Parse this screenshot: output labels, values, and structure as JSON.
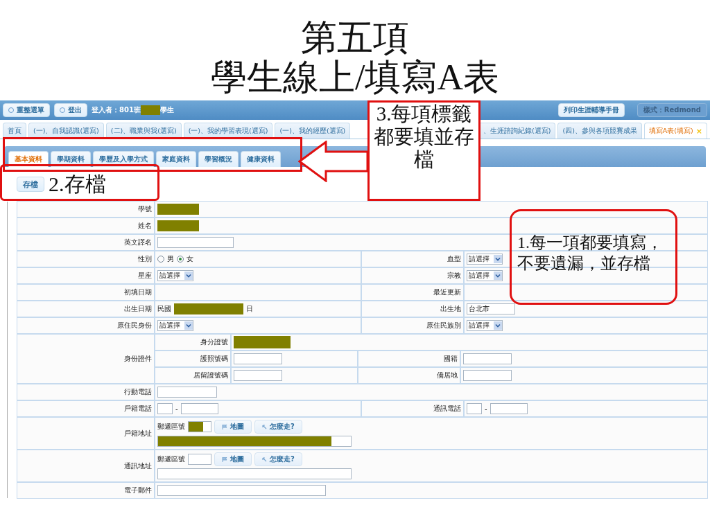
{
  "slide_title": [
    "第五項",
    "學生線上/填寫A表"
  ],
  "top_bar": {
    "buttons": [
      "重整選單",
      "登出"
    ],
    "login_prefix": "登入者：801班",
    "login_suffix": "學生",
    "print_button": "列印生涯輔導手冊",
    "theme": "樣式：Redmond"
  },
  "tabs": [
    {
      "label": "首頁",
      "selected": false
    },
    {
      "label": "(一)、自我認識(選寫)",
      "selected": false
    },
    {
      "label": "(二)、職業與我(選寫)",
      "selected": false
    },
    {
      "label": "(一)、我的學習表現(選寫)",
      "selected": false
    },
    {
      "label": "(一)、我的經歷(選寫)",
      "selected": false
    },
    {
      "label": "、生涯諮詢紀錄(選寫)",
      "selected": false
    },
    {
      "label": "(四)、參與各項競賽成果",
      "selected": false
    },
    {
      "label": "填寫A表(填寫)",
      "selected": true,
      "close": "×"
    }
  ],
  "subtabs": [
    {
      "label": "基本資料",
      "selected": true
    },
    {
      "label": "學期資料",
      "selected": false
    },
    {
      "label": "學歷及入學方式",
      "selected": false
    },
    {
      "label": "家庭資料",
      "selected": false
    },
    {
      "label": "學習概況",
      "selected": false
    },
    {
      "label": "健康資料",
      "selected": false
    }
  ],
  "save_button": "存檔",
  "form": {
    "rows": [
      {
        "label": "學號",
        "kind": "redacted"
      },
      {
        "label": "姓名",
        "kind": "redacted"
      },
      {
        "label": "英文譯名",
        "kind": "input"
      },
      {
        "label": "性別",
        "kind": "radio",
        "options": [
          {
            "label": "男",
            "selected": false
          },
          {
            "label": "女",
            "selected": true
          }
        ],
        "right": {
          "label": "血型",
          "kind": "select",
          "value": "請選擇"
        }
      },
      {
        "label": "星座",
        "kind": "select",
        "value": "請選擇",
        "right": {
          "label": "宗教",
          "kind": "select",
          "value": "請選擇"
        }
      },
      {
        "label": "初填日期",
        "kind": "empty",
        "right": {
          "label": "最近更新",
          "kind": "empty"
        }
      },
      {
        "label": "出生日期",
        "kind": "date",
        "prefix": "民國",
        "suffix": "日",
        "right": {
          "label": "出生地",
          "kind": "input",
          "value": "台北市"
        }
      },
      {
        "label": "原住民身份",
        "kind": "select",
        "value": "請選擇",
        "right": {
          "label": "原住民族別",
          "kind": "select",
          "value": "請選擇"
        }
      },
      {
        "label": "身份證件",
        "kind": "group",
        "children": [
          {
            "label": "身分證號",
            "kind": "redacted"
          },
          {
            "label": "護照號碼",
            "kind": "input",
            "right": {
              "label": "國籍",
              "kind": "input"
            }
          },
          {
            "label": "居留證號碼",
            "kind": "input",
            "right": {
              "label": "僑居地",
              "kind": "input"
            }
          }
        ]
      },
      {
        "label": "行動電話",
        "kind": "input"
      },
      {
        "label": "戶籍電話",
        "kind": "phone",
        "separator": "-",
        "right": {
          "label": "通訊電話",
          "kind": "phone",
          "separator": "-"
        }
      },
      {
        "label": "戶籍地址",
        "kind": "address",
        "zip_label": "郵遞區號",
        "redacted": true,
        "buttons": [
          "地圖",
          "怎麼走?"
        ]
      },
      {
        "label": "通訊地址",
        "kind": "address",
        "zip_label": "郵遞區號",
        "redacted": false,
        "buttons": [
          "地圖",
          "怎麼走?"
        ]
      },
      {
        "label": "電子郵件",
        "kind": "input"
      }
    ]
  },
  "annotations": {
    "save_note": "2.存檔",
    "fill_note": "1.每一項都要填寫，不要遺漏，並存檔",
    "tabs_note": "3.每項標籤都要填並存檔"
  }
}
